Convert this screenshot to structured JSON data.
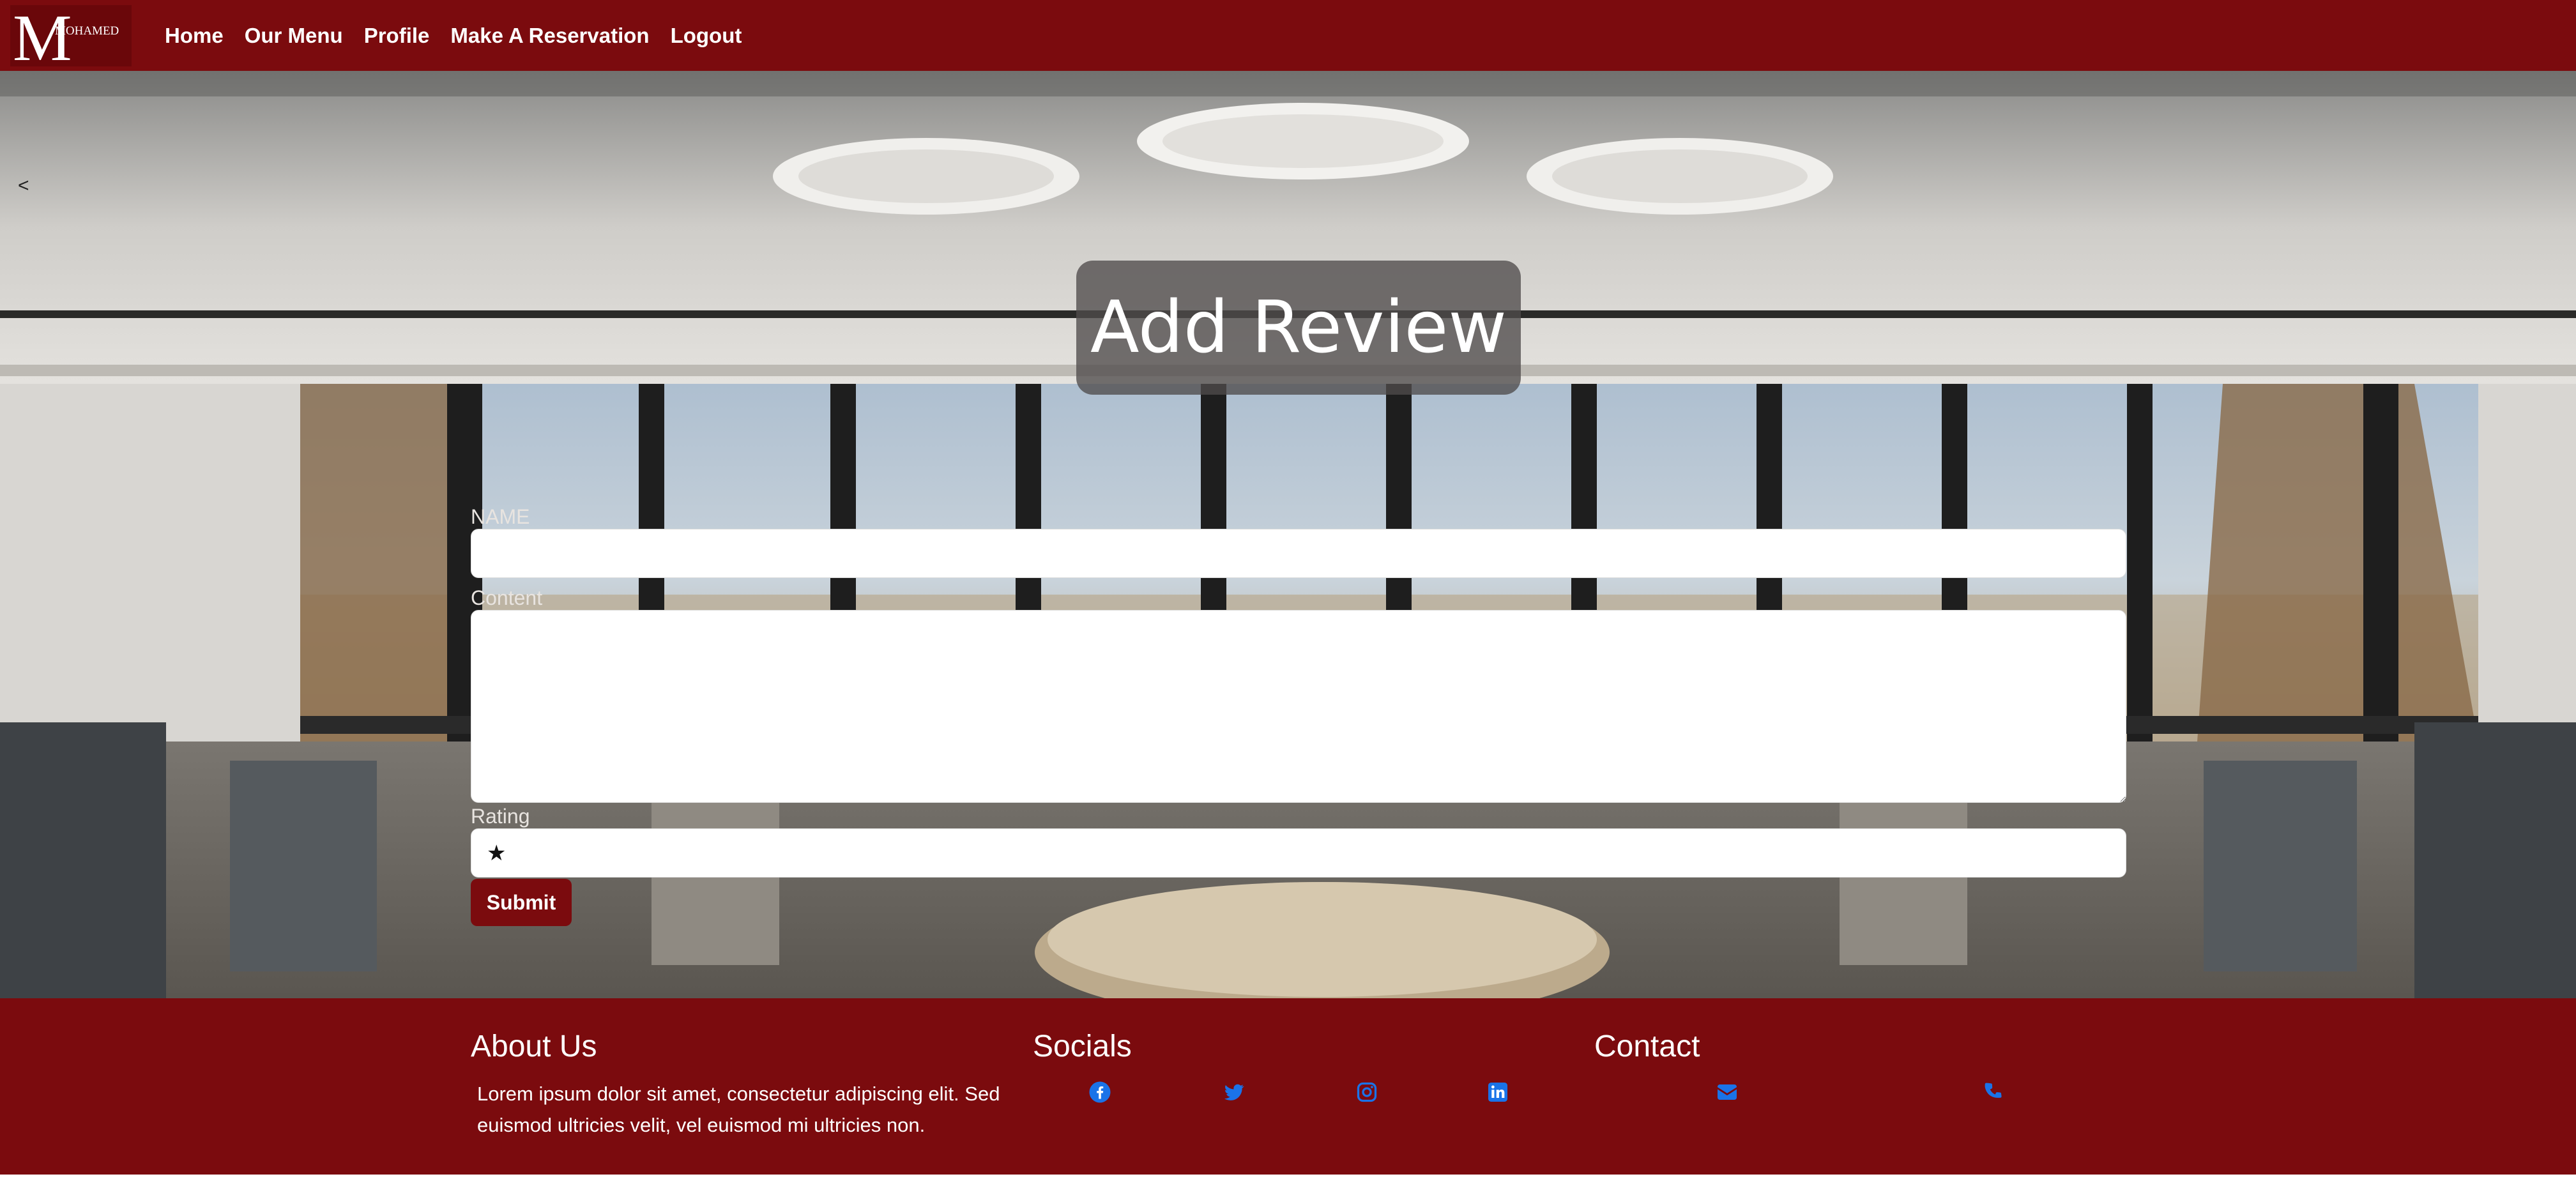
{
  "navbar": {
    "logo_text": "MOHAMED",
    "links": [
      "Home",
      "Our Menu",
      "Profile",
      "Make A Reservation",
      "Logout"
    ]
  },
  "page": {
    "back_label": "<",
    "title": "Add Review"
  },
  "form": {
    "name_label": "NAME",
    "content_label": "Content",
    "rating_label": "Rating",
    "rating_value": "★",
    "submit_label": "Submit"
  },
  "footer": {
    "about_title": "About Us",
    "about_text": "Lorem ipsum dolor sit amet, consectetur adipiscing elit. Sed euismod ultricies velit, vel euismod mi ultricies non.",
    "socials_title": "Socials",
    "contact_title": "Contact",
    "socials": [
      "facebook-icon",
      "twitter-icon",
      "instagram-icon",
      "linkedin-icon"
    ],
    "contacts": [
      "envelope-icon",
      "phone-icon"
    ]
  },
  "colors": {
    "brand": "#7b0b0e",
    "icon_blue": "#1a73e8"
  }
}
